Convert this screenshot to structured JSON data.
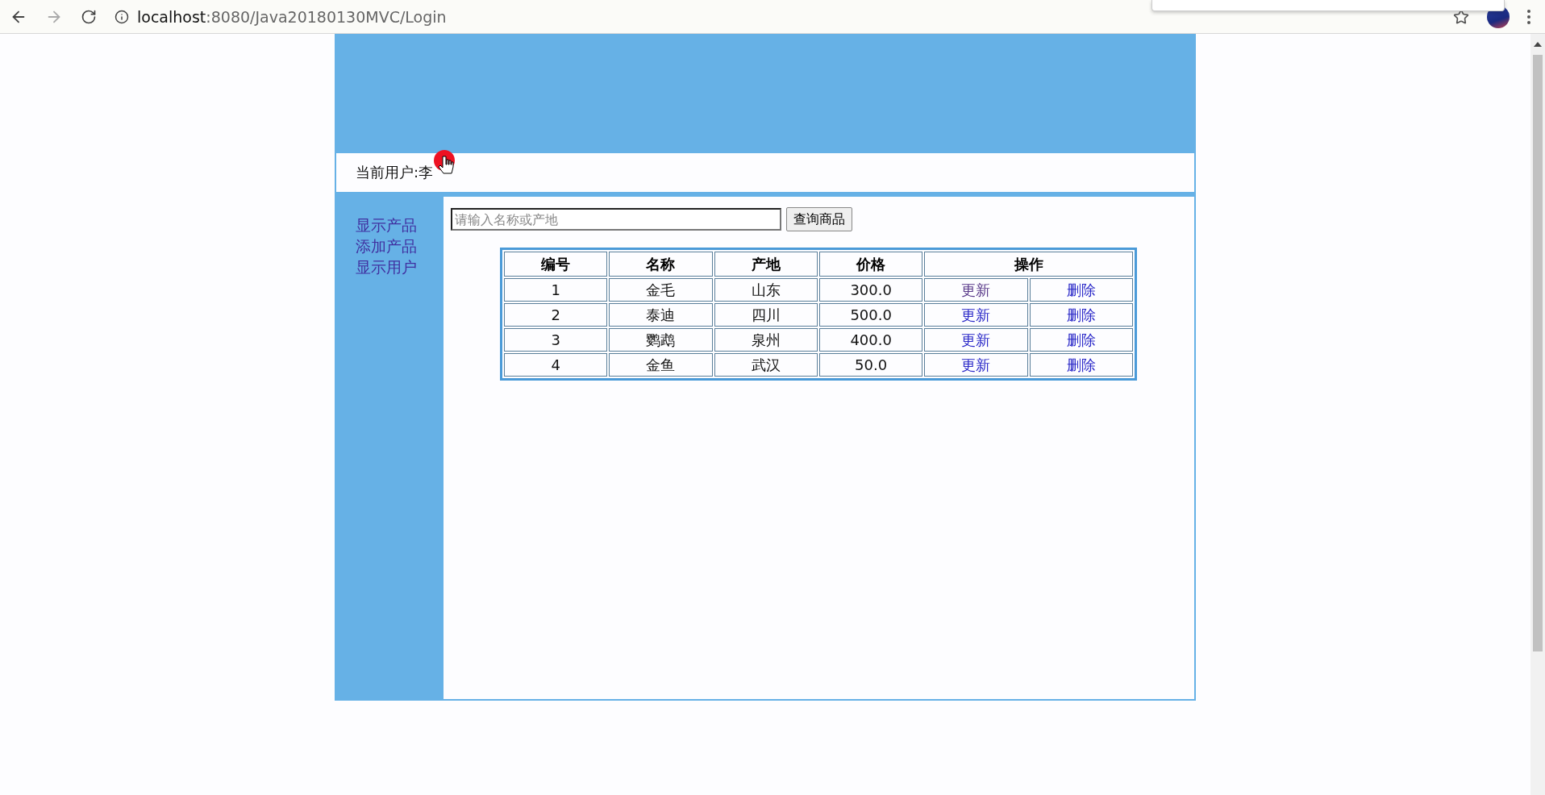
{
  "browser": {
    "url_host": "localhost",
    "url_rest": ":8080/Java20180130MVC/Login"
  },
  "user_bar": {
    "label": "当前用户:",
    "name": "李"
  },
  "sidebar": {
    "links": [
      {
        "label": "显示产品"
      },
      {
        "label": "添加产品"
      },
      {
        "label": "显示用户"
      }
    ]
  },
  "search": {
    "placeholder": "请输入名称或产地",
    "button": "查询商品"
  },
  "table": {
    "columns": [
      "编号",
      "名称",
      "产地",
      "价格",
      "操作"
    ],
    "rows": [
      {
        "id": "1",
        "name": "金毛",
        "origin": "山东",
        "price": "300.0",
        "update": {
          "label": "更新",
          "visited": true
        },
        "delete": {
          "label": "删除",
          "visited": false
        }
      },
      {
        "id": "2",
        "name": "泰迪",
        "origin": "四川",
        "price": "500.0",
        "update": {
          "label": "更新",
          "visited": false
        },
        "delete": {
          "label": "删除",
          "visited": false
        }
      },
      {
        "id": "3",
        "name": "鹦鹉",
        "origin": "泉州",
        "price": "400.0",
        "update": {
          "label": "更新",
          "visited": false
        },
        "delete": {
          "label": "删除",
          "visited": false
        }
      },
      {
        "id": "4",
        "name": "金鱼",
        "origin": "武汉",
        "price": "50.0",
        "update": {
          "label": "更新",
          "visited": false
        },
        "delete": {
          "label": "删除",
          "visited": false
        }
      }
    ]
  }
}
